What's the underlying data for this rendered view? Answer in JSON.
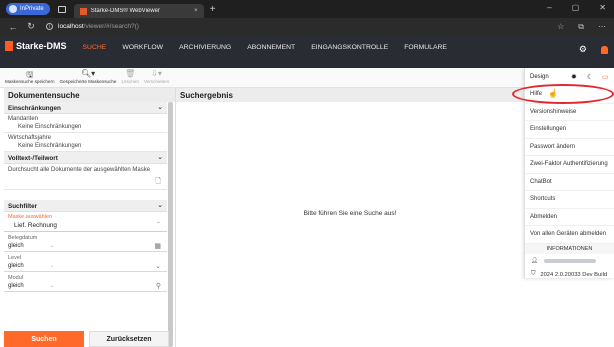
{
  "browser": {
    "inprivate_label": "InPrivate",
    "tab_title": "Starke-DMS® WebViewer",
    "tab_close": "×",
    "new_tab": "+",
    "url_host": "localhost",
    "url_path": "/viewer/#/search?()",
    "window_controls": [
      "–",
      "▢",
      "✕"
    ]
  },
  "app": {
    "logo_text": "Starke-DMS",
    "accent_color": "#ff6a2b",
    "nav": [
      {
        "label": "SUCHE",
        "active": true
      },
      {
        "label": "WORKFLOW",
        "active": false
      },
      {
        "label": "ARCHIVIERUNG",
        "active": false
      },
      {
        "label": "ABONNEMENT",
        "active": false
      },
      {
        "label": "EINGANGSKONTROLLE",
        "active": false
      },
      {
        "label": "FORMULARE",
        "active": false
      }
    ]
  },
  "toolbar": {
    "buttons": [
      {
        "label": "Maskensuche speichern",
        "icon": "save-icon",
        "enabled": true
      },
      {
        "label": "Gespeicherte Maskensuche",
        "icon": "search-icon",
        "enabled": true
      },
      {
        "label": "Löschen",
        "icon": "trash-icon",
        "enabled": false
      },
      {
        "label": "Verschieben",
        "icon": "move-icon",
        "enabled": false
      }
    ]
  },
  "search_panel": {
    "title": "Dokumentensuche",
    "restrictions_title": "Einschränkungen",
    "mandanten_label": "Mandanten",
    "mandanten_value": "Keine Einschränkungen",
    "wj_label": "Wirtschaftsjahre",
    "wj_value": "Keine Einschränkungen",
    "fulltext_title": "Volltext-/Teilwort",
    "fulltext_desc": "Durchsucht alle Dokumente der ausgewählten Maske",
    "filter_title": "Suchfilter",
    "mask_label": "Maske auswählen",
    "mask_value": "Lief. Rechnung",
    "fields": [
      {
        "label": "Belegdatum",
        "operator": "gleich"
      },
      {
        "label": "Level",
        "operator": "gleich"
      },
      {
        "label": "Modul",
        "operator": "gleich"
      }
    ],
    "search_button": "Suchen",
    "reset_button": "Zurücksetzen"
  },
  "results": {
    "title": "Suchergebnis",
    "empty_message": "Bitte führen Sie eine Suche aus!"
  },
  "menu": {
    "design_label": "Design",
    "items": [
      "Hilfe",
      "Versionshinweise",
      "Einstellungen",
      "Passwort ändern",
      "Zwei-Faktor Authentifizierung",
      "ChatBot",
      "Shortcuts",
      "Abmelden",
      "Von allen Geräten abmelden"
    ],
    "info_title": "INFORMATIONEN",
    "build": "2024 2.0.20033 Dev Build",
    "highlight_color": "#e0282e"
  }
}
